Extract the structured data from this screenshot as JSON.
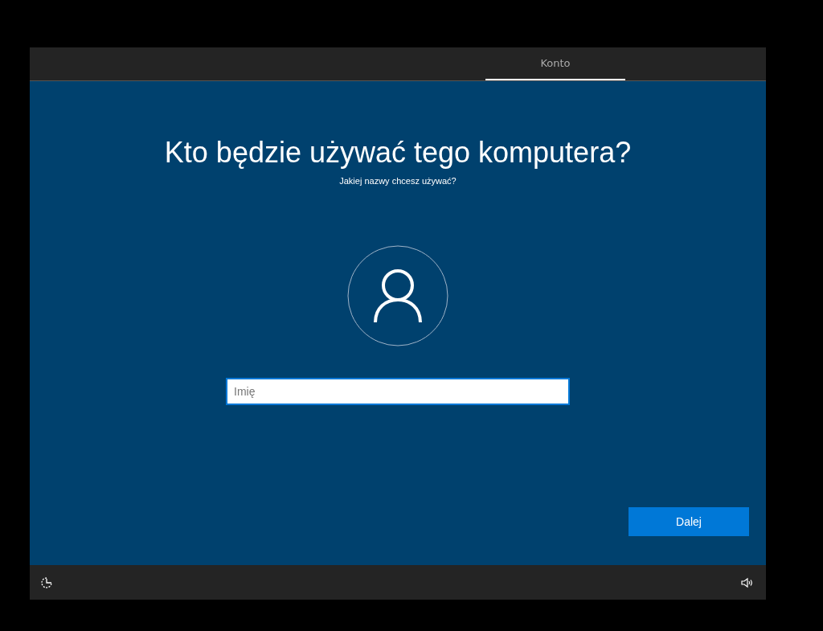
{
  "tabs": [
    {
      "label": "Konto",
      "selected": true
    }
  ],
  "title": "Kto będzie używać tego komputera?",
  "subtitle": "Jakiej nazwy chcesz używać?",
  "name_field": {
    "placeholder": "Imię"
  },
  "next_button": "Dalej"
}
